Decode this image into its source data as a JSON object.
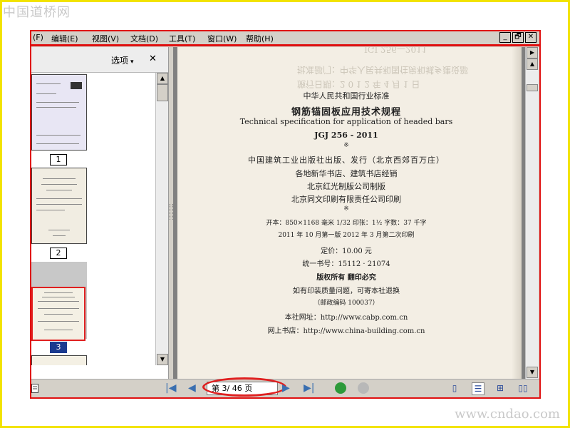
{
  "watermark": {
    "top": "中国道桥网",
    "bottom": "www.cndao.com"
  },
  "menubar": {
    "items": [
      "(F)",
      "编辑(E)",
      "视图(V)",
      "文档(D)",
      "工具(T)",
      "窗口(W)",
      "帮助(H)"
    ],
    "window_buttons": [
      "_",
      "🗗",
      "✕"
    ]
  },
  "sidebar": {
    "options_label": "选项",
    "options_caret": "▾",
    "close_label": "✕",
    "page_numbers": [
      "1",
      "2",
      "3"
    ]
  },
  "page_content": {
    "faint_lines": [
      "JGJ 256—2011",
      "批准部门：中华人民共和国住房和城乡建设部",
      "施行日期：2 0 1 2 年 4 月 1 日"
    ],
    "lines": [
      "中华人民共和国行业标准",
      "钢筋锚固板应用技术规程",
      "Technical specification for application of headed bars",
      "JGJ 256 - 2011",
      "※",
      "中国建筑工业出版社出版、发行（北京西郊百万庄）",
      "各地新华书店、建筑书店经销",
      "北京红光制版公司制版",
      "北京同文印刷有限责任公司印刷",
      "※",
      "开本：850×1168 毫米  1/32  印张：1½  字数：37 千字",
      "2011 年 10 月第一版     2012 年 3 月第二次印刷",
      "定价：10.00 元",
      "统一书号：15112 · 21074",
      "版权所有   翻印必究",
      "如有印装质量问题，可寄本社退换",
      "（邮政编码 100037）",
      "本社网址：http://www.cabp.com.cn",
      "网上书店：http://www.china-building.com.cn"
    ]
  },
  "statusbar": {
    "page_indicator": "第 3/ 46 页"
  },
  "colors": {
    "frame": "#f2e300",
    "highlight": "#e01010",
    "selected_page": "#1a3a8f"
  }
}
